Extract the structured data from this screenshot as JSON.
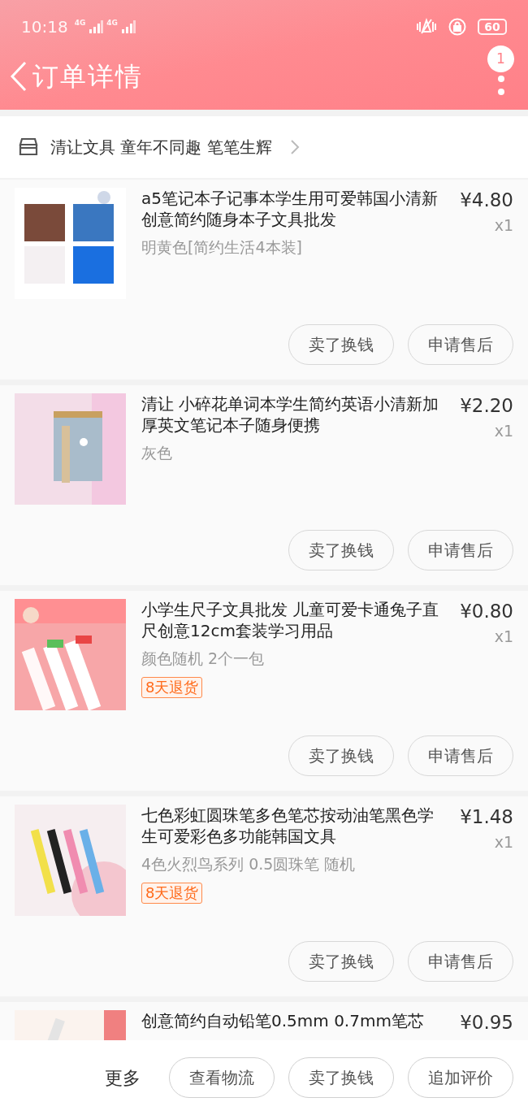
{
  "status_bar": {
    "time": "10:18",
    "networks": [
      "4G",
      "4G"
    ],
    "battery": "60"
  },
  "header": {
    "title": "订单详情",
    "badge": "1"
  },
  "shop": {
    "name": "清让文具 童年不同趣 笔笔生辉"
  },
  "items": [
    {
      "title": "a5笔记本子记事本学生用可爱韩国小清新创意简约随身本子文具批发",
      "price": "¥4.80",
      "qty": "x1",
      "spec": "明黄色[简约生活4本装]",
      "buttons": [
        "卖了换钱",
        "申请售后"
      ]
    },
    {
      "title": "清让 小碎花单词本学生简约英语小清新加厚英文笔记本子随身便携",
      "price": "¥2.20",
      "qty": "x1",
      "spec": "灰色",
      "buttons": [
        "卖了换钱",
        "申请售后"
      ]
    },
    {
      "title": "小学生尺子文具批发 儿童可爱卡通兔子直尺创意12cm套装学习用品",
      "price": "¥0.80",
      "qty": "x1",
      "spec": "颜色随机 2个一包",
      "tag": "8天退货",
      "buttons": [
        "卖了换钱",
        "申请售后"
      ]
    },
    {
      "title": "七色彩虹圆珠笔多色笔芯按动油笔黑色学生可爱彩色多功能韩国文具",
      "price": "¥1.48",
      "qty": "x1",
      "spec": "4色火烈鸟系列 0.5圆珠笔 随机",
      "tag": "8天退货",
      "buttons": [
        "卖了换钱",
        "申请售后"
      ]
    },
    {
      "title": "创意简约自动铅笔0.5mm 0.7mm笔芯",
      "price": "¥0.95"
    }
  ],
  "bottom_bar": {
    "more": "更多",
    "buttons": [
      "查看物流",
      "卖了换钱",
      "追加评价"
    ]
  }
}
